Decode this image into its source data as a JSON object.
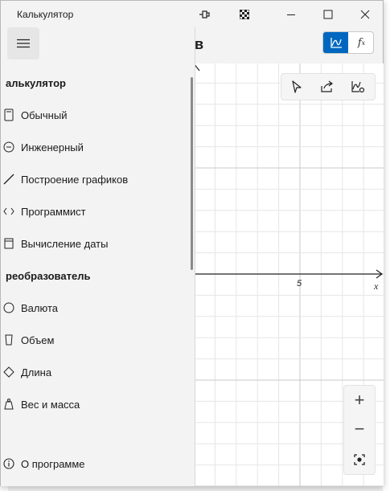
{
  "window": {
    "title": "Калькулятор"
  },
  "header": {
    "title_fragment": "ов"
  },
  "nav": {
    "calculator_category": "алькулятор",
    "converter_category": "реобразователь",
    "items_calc": [
      {
        "label": "Обычный",
        "icon": "standard-calculator-icon"
      },
      {
        "label": "Инженерный",
        "icon": "scientific-icon"
      },
      {
        "label": "Построение графиков",
        "icon": "graphing-icon"
      },
      {
        "label": "Программист",
        "icon": "programmer-icon"
      },
      {
        "label": "Вычисление даты",
        "icon": "calendar-icon"
      }
    ],
    "items_conv": [
      {
        "label": "Валюта",
        "icon": "currency-icon"
      },
      {
        "label": "Объем",
        "icon": "volume-icon"
      },
      {
        "label": "Длина",
        "icon": "length-icon"
      },
      {
        "label": "Вес и масса",
        "icon": "weight-icon"
      }
    ],
    "about": {
      "label": "О программе",
      "icon": "info-icon"
    }
  },
  "mode_toggle": {
    "graph_icon": "graph-mode-icon",
    "function_label": "f"
  },
  "graph": {
    "tick_label_x": "5",
    "axis_label_x": "x"
  },
  "zoom": {
    "in": "+",
    "out": "−"
  },
  "colors": {
    "accent": "#0067c0",
    "nav_bg": "#f3f3f3",
    "grid_minor": "#e6e6e6",
    "grid_major": "#c8c8c8"
  }
}
